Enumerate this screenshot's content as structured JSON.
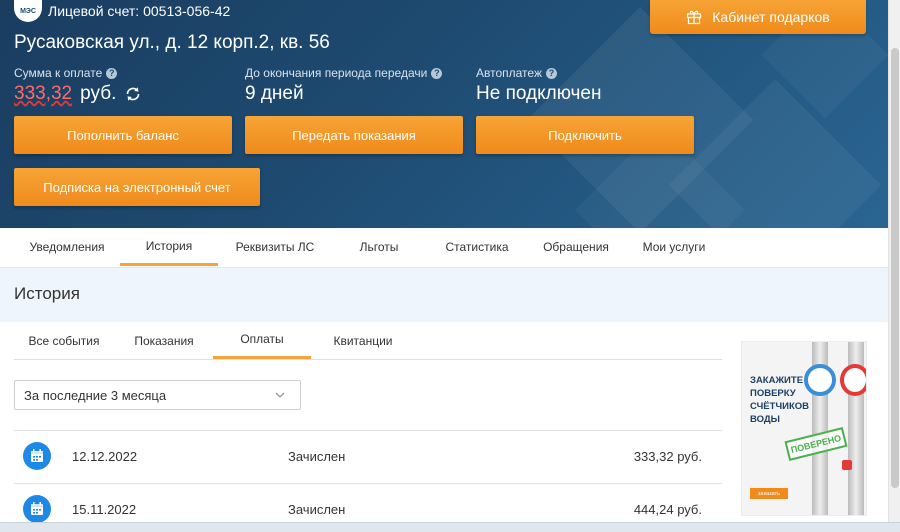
{
  "header": {
    "logo_text": "МЭС",
    "account": "Лицевой счет: 00513-056-42",
    "address": "Русаковская ул., д. 12 корп.2, кв. 56",
    "gift_button": "Кабинет подарков",
    "due_label": "Сумма к оплате",
    "due_amount": "333,32",
    "due_currency": "руб.",
    "period_label": "До окончания периода передачи",
    "period_value": "9 дней",
    "autopay_label": "Автоплатеж",
    "autopay_value": "Не подключен",
    "help_glyph": "?",
    "buttons": {
      "top_up": "Пополнить баланс",
      "submit_readings": "Передать показания",
      "connect": "Подключить",
      "e_invoice": "Подписка на электронный счет"
    }
  },
  "tabs": [
    "Уведомления",
    "История",
    "Реквизиты ЛС",
    "Льготы",
    "Статистика",
    "Обращения",
    "Мои услуги"
  ],
  "active_tab": "История",
  "history": {
    "title": "История",
    "subtabs": [
      "Все события",
      "Показания",
      "Оплаты",
      "Квитанции"
    ],
    "active_subtab": "Оплаты",
    "period_select": "За последние 3 месяца",
    "rows": [
      {
        "date": "12.12.2022",
        "status": "Зачислен",
        "sum": "333,32 руб."
      },
      {
        "date": "15.11.2022",
        "status": "Зачислен",
        "sum": "444,24 руб."
      }
    ]
  },
  "ad": {
    "text": "ЗАКАЖИТЕ ПОВЕРКУ СЧЁТЧИКОВ ВОДЫ",
    "stamp": "ПОВЕРЕНО",
    "button": "заказать"
  },
  "colors": {
    "header_bg": "#1e4b72",
    "accent_orange": "#f08a1c",
    "tab_underline": "#f5a33b",
    "history_bg": "#eef5fc",
    "calendar_icon": "#1e88e5"
  },
  "icons": [
    "gift-icon",
    "refresh-icon",
    "help-icon",
    "chevron-down-icon",
    "calendar-icon"
  ]
}
